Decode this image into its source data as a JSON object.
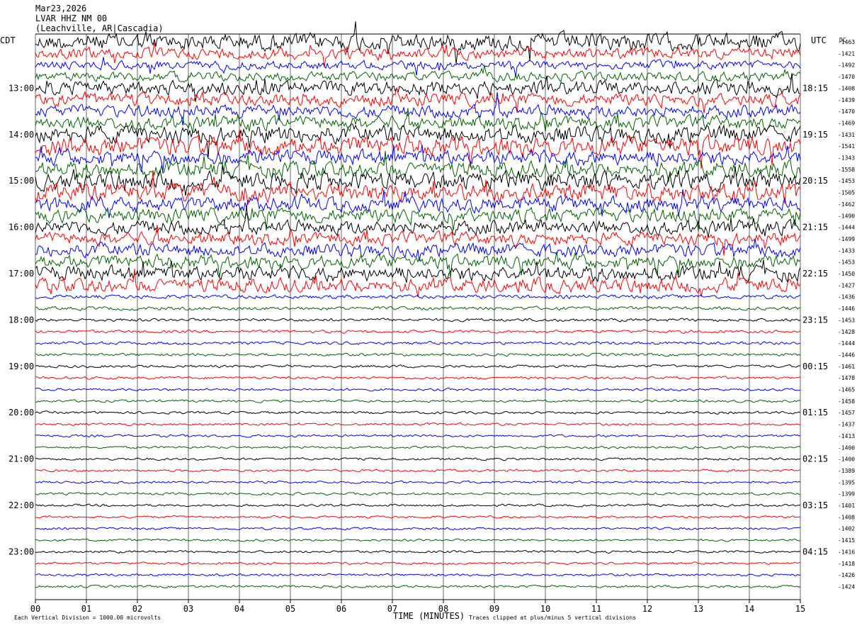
{
  "chart_data": {
    "type": "line",
    "title_lines": [
      "Mar23,2026",
      "LVAR HHZ NM 00",
      "(Leachville, AR|Cascadia)"
    ],
    "left_tz": "CDT",
    "right_tz": "UTC",
    "dc_label": "DC",
    "left_hour_labels": [
      "13:00",
      "14:00",
      "15:00",
      "16:00",
      "17:00",
      "18:00",
      "19:00",
      "20:00",
      "21:00",
      "22:00",
      "23:00"
    ],
    "right_hour_labels": [
      "18:15",
      "19:15",
      "20:15",
      "21:15",
      "22:15",
      "23:15",
      "00:15",
      "01:15",
      "02:15",
      "03:15",
      "04:15"
    ],
    "x_ticks": [
      "00",
      "01",
      "02",
      "03",
      "04",
      "05",
      "06",
      "07",
      "08",
      "09",
      "10",
      "11",
      "12",
      "13",
      "14",
      "15"
    ],
    "xlim": [
      0,
      15
    ],
    "xlabel": "TIME (MINUTES)",
    "footer_left": "Each Vertical Division = 1000.00 microvolts",
    "footer_right": "Traces clipped at plus/minus 5 vertical divisions",
    "trace_colors": [
      "#000000",
      "#ff0000",
      "#0000ff",
      "#006400"
    ],
    "dc_offsets": [
      -1463,
      -1421,
      -1492,
      -1470,
      -1408,
      -1439,
      -1470,
      -1469,
      -1431,
      -1541,
      -1343,
      -1558,
      -1453,
      -1505,
      -1462,
      -1490,
      -1444,
      -1499,
      -1433,
      -1453,
      -1450,
      -1427,
      -1436,
      -1446,
      -1453,
      -1428,
      -1444,
      -1446,
      -1461,
      -1478,
      -1465,
      -1458,
      -1457,
      -1437,
      -1413,
      -1400,
      -1400,
      -1389,
      -1395,
      -1399,
      -1401,
      -1408,
      -1402,
      -1415,
      -1416,
      -1418,
      -1426,
      -1424
    ],
    "trace_activity": [
      2.2,
      1.4,
      1.1,
      1.2,
      1.8,
      1.6,
      1.6,
      1.7,
      2.2,
      2.4,
      1.9,
      2.0,
      2.3,
      2.3,
      1.9,
      1.8,
      1.8,
      1.6,
      1.7,
      1.7,
      1.9,
      1.8,
      0.5,
      0.45,
      0.4,
      0.38,
      0.38,
      0.36,
      0.35,
      0.33,
      0.33,
      0.32,
      0.33,
      0.32,
      0.32,
      0.31,
      0.31,
      0.31,
      0.31,
      0.3,
      0.3,
      0.3,
      0.3,
      0.3,
      0.31,
      0.3,
      0.31,
      0.32
    ]
  }
}
